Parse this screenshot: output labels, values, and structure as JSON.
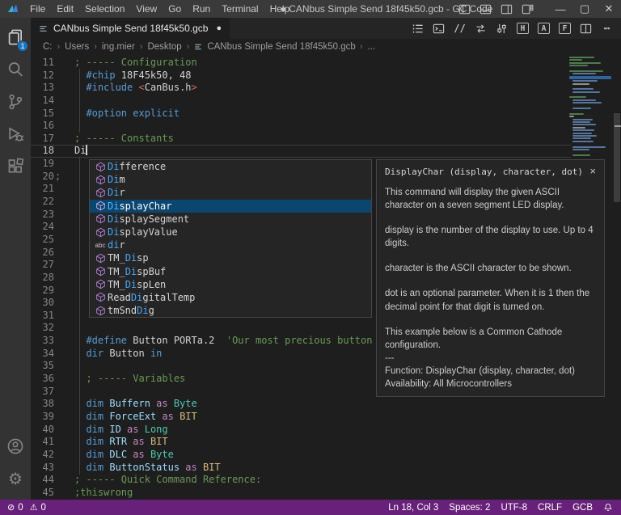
{
  "window": {
    "menu_items": [
      "File",
      "Edit",
      "Selection",
      "View",
      "Go",
      "Run",
      "Terminal",
      "Help"
    ],
    "title": "● CANbus Simple Send 18f45k50.gcb - GC Code",
    "minimize_glyph": "—",
    "maximize_glyph": "▢",
    "close_glyph": "✕"
  },
  "activity_bar": {
    "explorer_badge": "1"
  },
  "tab_bar": {
    "active_tab_label": "CANbus Simple Send 18f45k50.gcb",
    "dirty_dot": "●"
  },
  "editor_actions": [
    {
      "name": "outline-list-icon",
      "glyph": "svg:list"
    },
    {
      "name": "open-terminal-icon",
      "glyph": "svg:terminal"
    },
    {
      "name": "toggle-comment-icon",
      "glyph": "//"
    },
    {
      "name": "compile-icon",
      "glyph": "svg:compile"
    },
    {
      "name": "compile-flash-icon",
      "glyph": "svg:flash"
    },
    {
      "name": "hex-view-icon",
      "glyph": "H",
      "boxed": true
    },
    {
      "name": "ascii-view-icon",
      "glyph": "A",
      "boxed": true
    },
    {
      "name": "format-icon",
      "glyph": "F",
      "boxed": true
    },
    {
      "name": "split-editor-icon",
      "glyph": "svg:split"
    },
    {
      "name": "more-actions-icon",
      "glyph": "⋯"
    }
  ],
  "breadcrumb": {
    "segments": [
      "C:",
      "Users",
      "ing.mier",
      "Desktop"
    ],
    "file": "CANbus Simple Send 18f45k50.gcb",
    "ellipsis": "..."
  },
  "editor": {
    "lines": [
      {
        "n": 11,
        "t": [
          [
            "cm",
            "; ----- Configuration"
          ]
        ]
      },
      {
        "n": 12,
        "t": [
          [
            "wh",
            "  "
          ],
          [
            "kw",
            "#chip"
          ],
          [
            "wh",
            " 18F45k50, 48"
          ]
        ]
      },
      {
        "n": 13,
        "t": [
          [
            "wh",
            "  "
          ],
          [
            "kw",
            "#include"
          ],
          [
            "wh",
            " "
          ],
          [
            "rd",
            "<"
          ],
          [
            "wh",
            "CanBus.h"
          ],
          [
            "rd",
            ">"
          ]
        ]
      },
      {
        "n": 14,
        "t": []
      },
      {
        "n": 15,
        "t": [
          [
            "wh",
            "  "
          ],
          [
            "kw",
            "#option explicit"
          ]
        ]
      },
      {
        "n": 16,
        "t": []
      },
      {
        "n": 17,
        "t": [
          [
            "cm",
            "; ----- Constants"
          ]
        ]
      },
      {
        "n": 18,
        "t": [
          [
            "wh",
            "Di"
          ]
        ],
        "current": true,
        "cursor": true
      },
      {
        "n": 19,
        "t": []
      },
      {
        "n": 20,
        "t": [],
        "gutter_note": ";"
      },
      {
        "n": 21,
        "t": []
      },
      {
        "n": 22,
        "t": []
      },
      {
        "n": 23,
        "t": []
      },
      {
        "n": 24,
        "t": []
      },
      {
        "n": 25,
        "t": []
      },
      {
        "n": 26,
        "t": []
      },
      {
        "n": 27,
        "t": []
      },
      {
        "n": 28,
        "t": []
      },
      {
        "n": 29,
        "t": []
      },
      {
        "n": 30,
        "t": []
      },
      {
        "n": 31,
        "t": []
      },
      {
        "n": 32,
        "t": []
      },
      {
        "n": 33,
        "t": [
          [
            "wh",
            "  "
          ],
          [
            "kw",
            "#define"
          ],
          [
            "wh",
            " Button PORTa.2"
          ],
          [
            "cm",
            "  'Our most precious button"
          ]
        ]
      },
      {
        "n": 34,
        "t": [
          [
            "wh",
            "  "
          ],
          [
            "kw",
            "dir"
          ],
          [
            "wh",
            " Button "
          ],
          [
            "kw",
            "in"
          ]
        ]
      },
      {
        "n": 35,
        "t": []
      },
      {
        "n": 36,
        "t": [
          [
            "wh",
            "  "
          ],
          [
            "cm",
            "; ----- Variables"
          ]
        ]
      },
      {
        "n": 37,
        "t": []
      },
      {
        "n": 38,
        "t": [
          [
            "wh",
            "  "
          ],
          [
            "kw",
            "dim"
          ],
          [
            "id",
            " Buffern "
          ],
          [
            "op",
            "as"
          ],
          [
            "ty",
            " Byte"
          ]
        ]
      },
      {
        "n": 39,
        "t": [
          [
            "wh",
            "  "
          ],
          [
            "kw",
            "dim"
          ],
          [
            "id",
            " ForceExt "
          ],
          [
            "op",
            "as"
          ],
          [
            "yl",
            " BIT"
          ]
        ]
      },
      {
        "n": 40,
        "t": [
          [
            "wh",
            "  "
          ],
          [
            "kw",
            "dim"
          ],
          [
            "id",
            " ID "
          ],
          [
            "op",
            "as"
          ],
          [
            "ty",
            " Long"
          ]
        ]
      },
      {
        "n": 41,
        "t": [
          [
            "wh",
            "  "
          ],
          [
            "kw",
            "dim"
          ],
          [
            "id",
            " RTR "
          ],
          [
            "op",
            "as"
          ],
          [
            "yl",
            " BIT"
          ]
        ]
      },
      {
        "n": 42,
        "t": [
          [
            "wh",
            "  "
          ],
          [
            "kw",
            "dim"
          ],
          [
            "id",
            " DLC "
          ],
          [
            "op",
            "as"
          ],
          [
            "ty",
            " Byte"
          ]
        ]
      },
      {
        "n": 43,
        "t": [
          [
            "wh",
            "  "
          ],
          [
            "kw",
            "dim"
          ],
          [
            "id",
            " ButtonStatus "
          ],
          [
            "op",
            "as"
          ],
          [
            "yl",
            " BIT"
          ]
        ]
      },
      {
        "n": 44,
        "t": [
          [
            "cm",
            "; ----- Quick Command Reference:"
          ]
        ]
      },
      {
        "n": 45,
        "t": [
          [
            "cm",
            ";thiswrong"
          ]
        ]
      }
    ]
  },
  "suggest_widget": {
    "items": [
      {
        "icon": "module",
        "pre": "",
        "match": "Di",
        "post": "fference"
      },
      {
        "icon": "module",
        "pre": "",
        "match": "Di",
        "post": "m"
      },
      {
        "icon": "module",
        "pre": "",
        "match": "Di",
        "post": "r"
      },
      {
        "icon": "module",
        "pre": "",
        "match": "Di",
        "post": "splayChar",
        "selected": true
      },
      {
        "icon": "module",
        "pre": "",
        "match": "Di",
        "post": "splaySegment"
      },
      {
        "icon": "module",
        "pre": "",
        "match": "Di",
        "post": "splayValue"
      },
      {
        "icon": "text",
        "pre": "",
        "match": "di",
        "post": "r"
      },
      {
        "icon": "module",
        "pre": "TM_",
        "match": "Di",
        "post": "sp"
      },
      {
        "icon": "module",
        "pre": "TM_",
        "match": "Di",
        "post": "spBuf"
      },
      {
        "icon": "module",
        "pre": "TM_",
        "match": "Di",
        "post": "spLen"
      },
      {
        "icon": "module",
        "pre": "Read",
        "match": "Di",
        "post": "gitalTemp"
      },
      {
        "icon": "module",
        "pre": "tmSnd",
        "match": "Di",
        "post": "g"
      }
    ]
  },
  "doc_popup": {
    "title": "DisplayChar (display, character, dot)",
    "close_glyph": "×",
    "paragraphs": [
      {
        "text": "This command will display the given ASCII character on a seven segment LED display.",
        "gap": true
      },
      {
        "text": "display is the number of the display to use. Up to 4 digits.",
        "gap": true
      },
      {
        "text": "character is the ASCII character to be shown.",
        "gap": true
      },
      {
        "text": "dot is an optional parameter. When it is 1 then the decimal point for that digit is turned on.",
        "gap": true
      },
      {
        "text": "This example below is a Common Cathode configuration.",
        "gap": false
      },
      {
        "text": "---",
        "gap": false
      },
      {
        "text": "Function: DisplayChar (display, character, dot)",
        "gap": false
      },
      {
        "text": "Availability: All Microcontrollers",
        "gap": false
      }
    ]
  },
  "status_bar": {
    "errors": "0",
    "warnings": "0",
    "items": [
      "Ln 18, Col 3",
      "Spaces: 2",
      "UTF-8",
      "CRLF",
      "GCB"
    ]
  },
  "minimap_rows": "g:60:0,g:30:0,g:75:0,g:45:0,x:0:0,g:80:0,b:55:1,sel:100:0,b:60:1,w:40:1,x:0:0,b:50:1,b:65:1,x:0:0,g:40:0,b:55:1,b:70:1,x:0:0,b:45:1,x:0:0,g:35:0,w:12:0,b:48:1,b:42:1,b:55:1,w:30:1,b:52:1,b:47:1,b:58:1,b:44:1,b:50:1,x:0:0,b:78:1,b:40:1,x:0:0,g:42:1,x:0:0,b:55:1,b:50:1,b:43:1,b:48:1,b:52:1,b:60:1,g:70:0,g:28:0,g:55:0,g:38:0,b:45:1,g:50:0,b:35:1,g:60:0,g:44:0,x:0:0,b:40:1,g:52:0,x:0:0,b:30:1,g:45:0,g:58:0,g:36:0,x:0:0,b:42:1,g:50:0,w:25:0,g:40:0",
  "colors": {
    "status_bar": "#68217A",
    "badge": "#1277c9",
    "suggest_selected": "#094771",
    "suggest_match": "#47a8f5",
    "comment": "#6A9955",
    "keyword": "#569CD6"
  }
}
